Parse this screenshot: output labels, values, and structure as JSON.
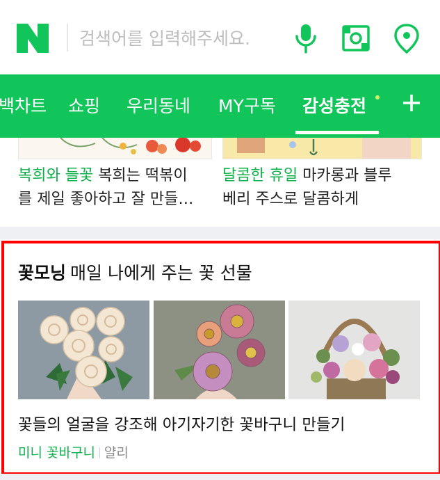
{
  "search": {
    "placeholder": "검색어를 입력해주세요."
  },
  "icons": {
    "logo": "naver-n-logo",
    "mic": "microphone-icon",
    "lens": "camera-lens-icon",
    "location": "location-pin-icon",
    "plus": "plus-icon"
  },
  "colors": {
    "brand": "#12C55A",
    "accent_text": "#10B04A",
    "highlight": "#FF0000"
  },
  "nav": {
    "tabs": [
      {
        "label": "백차트"
      },
      {
        "label": "쇼핑"
      },
      {
        "label": "우리동네"
      },
      {
        "label": "MY구독"
      },
      {
        "label": "감성충전",
        "active": true
      }
    ]
  },
  "cards": [
    {
      "tag": "복희와 들꽃",
      "text_line1": " 복희는 떡볶이",
      "text_line2": "를 제일 좋아하고 잘 만들…"
    },
    {
      "tag": "달콤한 휴일",
      "text_line1": " 마카롱과 블루",
      "text_line2": "베리 주스로 달콤하게"
    }
  ],
  "section": {
    "name": "꽃모닝",
    "subtitle": "매일 나에게 주는 꽃 선물",
    "photos": [
      "white-roses",
      "pink-zinnias",
      "flower-basket"
    ],
    "article_title": "꽃들의 얼굴을 강조해 아기자기한 꽃바구니 만들기",
    "category": "미니 꽃바구니",
    "author": "얄리"
  }
}
